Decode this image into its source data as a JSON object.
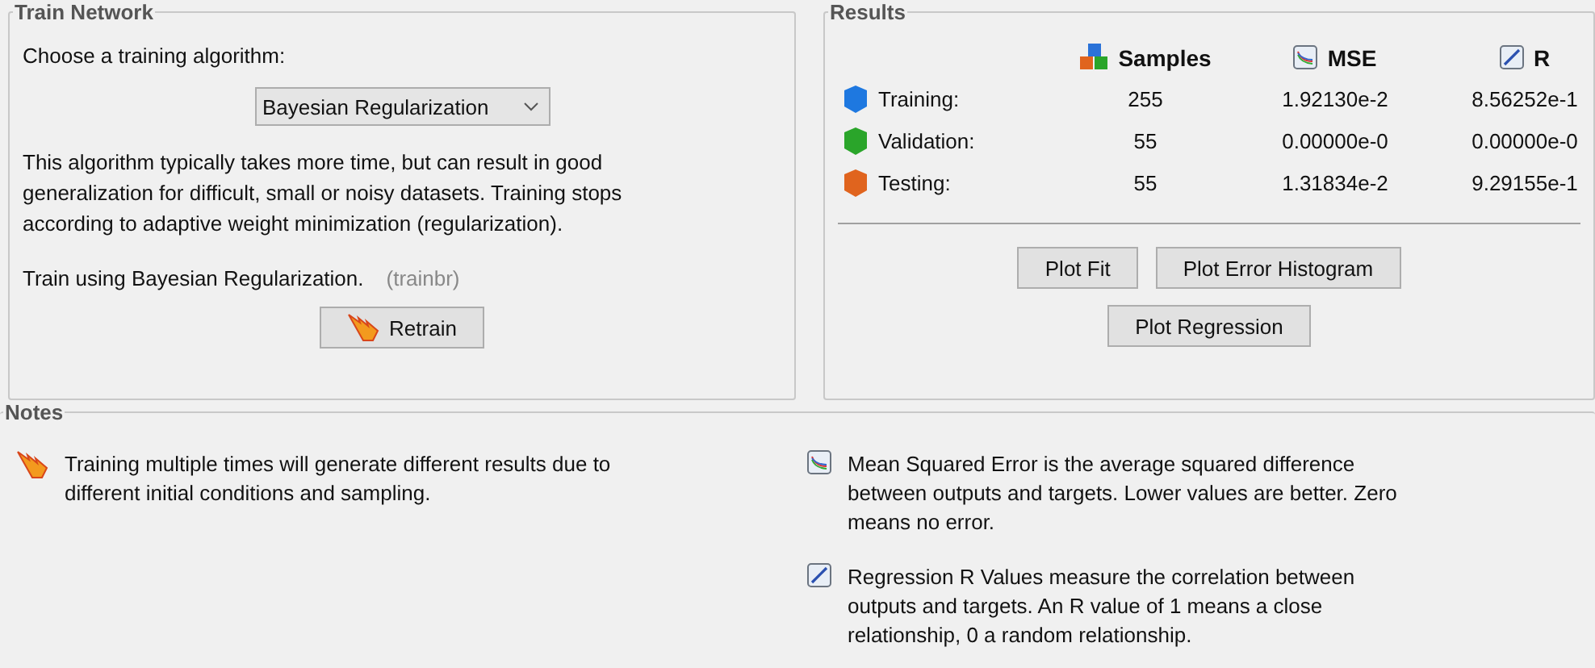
{
  "train_network": {
    "title": "Train Network",
    "prompt": "Choose a training algorithm:",
    "algorithm": "Bayesian Regularization",
    "description": "This algorithm typically takes more time, but can result in good generalization for difficult, small or noisy datasets. Training stops according to adaptive weight minimization (regularization).",
    "train_using": "Train using Bayesian Regularization.",
    "function_name": "(trainbr)",
    "retrain_button": "Retrain"
  },
  "results": {
    "title": "Results",
    "columns": [
      {
        "label": "Samples",
        "kind": "cubes"
      },
      {
        "label": "MSE",
        "kind": "mse"
      },
      {
        "label": "R",
        "kind": "r"
      }
    ],
    "rows": [
      {
        "label": "Training:",
        "color": "#1e78e0",
        "samples": "255",
        "mse": "1.92130e-2",
        "r": "8.56252e-1"
      },
      {
        "label": "Validation:",
        "color": "#2aa52a",
        "samples": "55",
        "mse": "0.00000e-0",
        "r": "0.00000e-0"
      },
      {
        "label": "Testing:",
        "color": "#e0641e",
        "samples": "55",
        "mse": "1.31834e-2",
        "r": "9.29155e-1"
      }
    ],
    "buttons": [
      [
        "Plot Fit",
        "Plot Error Histogram"
      ],
      [
        "Plot Regression"
      ]
    ]
  },
  "notes": {
    "title": "Notes",
    "items": [
      [
        {
          "kind": "retrain",
          "text": "Training multiple times will generate different results due to different initial conditions and sampling."
        }
      ],
      [
        {
          "kind": "mse",
          "text": "Mean Squared Error is the average squared difference between outputs and targets. Lower values are better. Zero means no error."
        },
        {
          "kind": "r",
          "text": "Regression R Values measure the correlation between outputs and targets. An R value of 1 means a close relationship, 0 a random relationship."
        }
      ]
    ]
  }
}
